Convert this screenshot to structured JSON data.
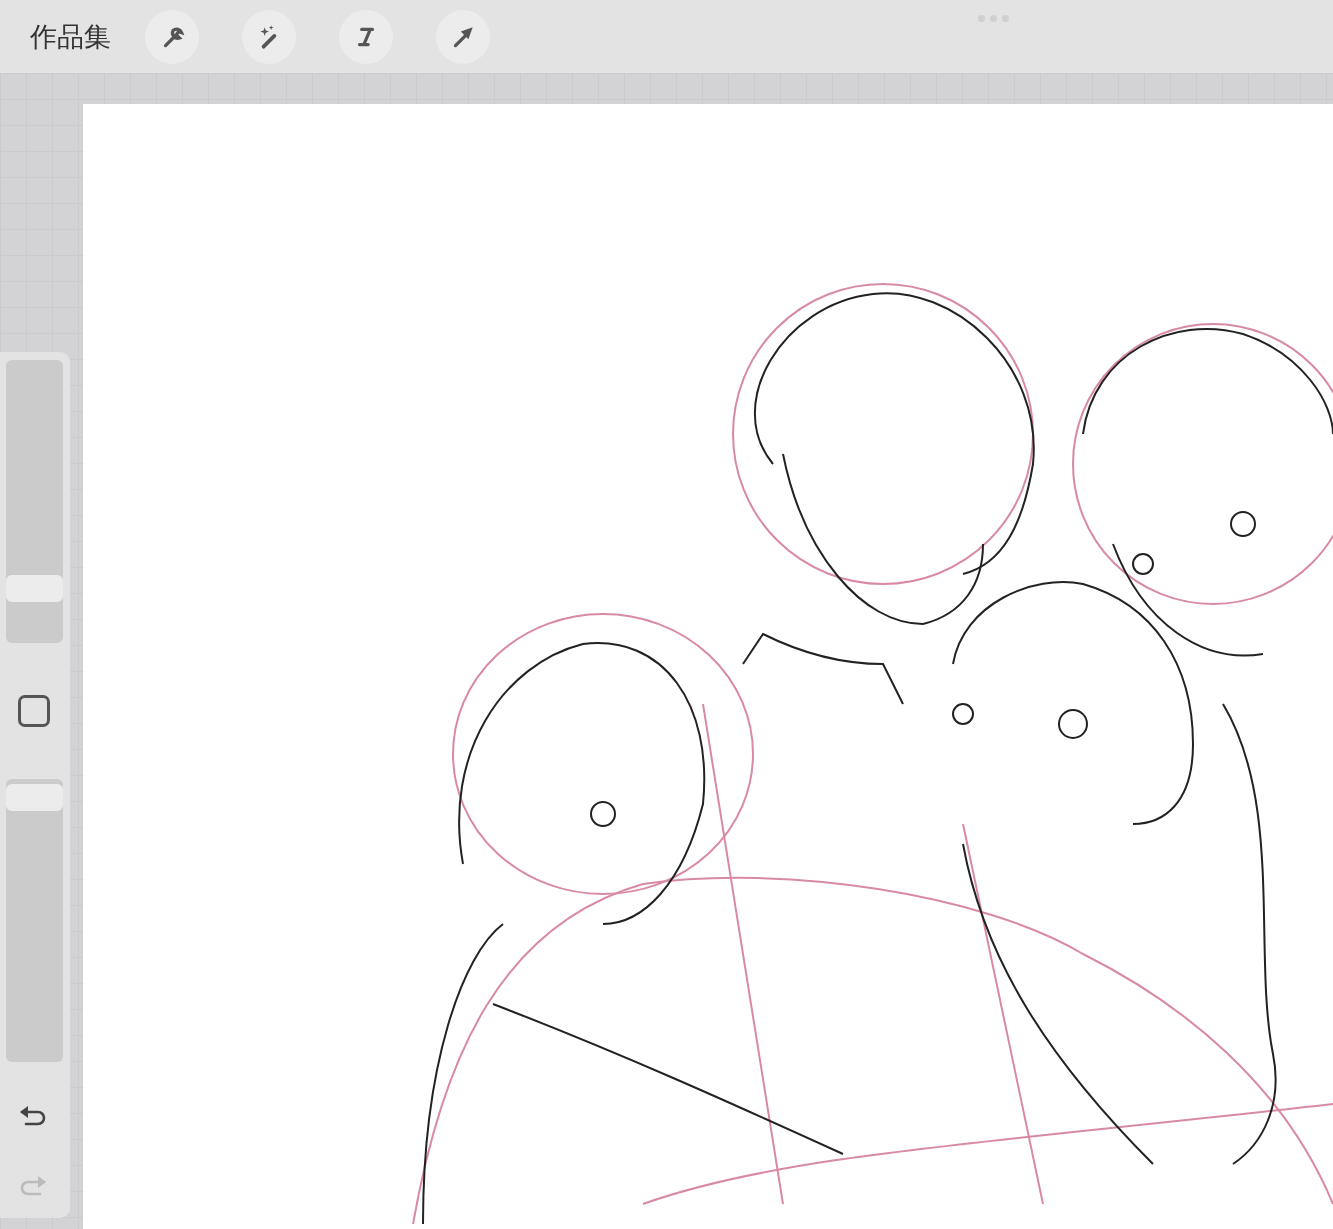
{
  "toolbar": {
    "gallery_label": "作品集",
    "tools": [
      {
        "kind": "wrench"
      },
      {
        "kind": "wand"
      },
      {
        "kind": "s-select"
      },
      {
        "kind": "arrow"
      }
    ]
  },
  "sidebar": {
    "brush_size": {
      "level": 0.16
    },
    "opacity": {
      "level": 0.98
    },
    "undo": {
      "disabled": false
    },
    "redo": {
      "disabled": true
    }
  }
}
